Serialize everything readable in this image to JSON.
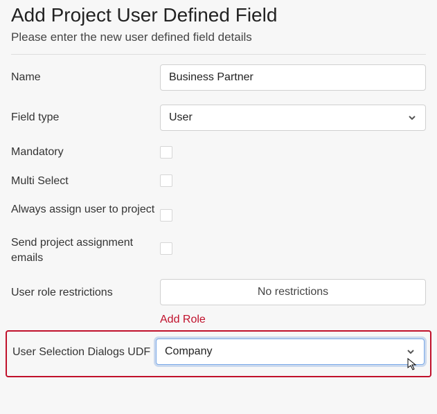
{
  "header": {
    "title": "Add Project User Defined Field",
    "subtitle": "Please enter the new user defined field details"
  },
  "labels": {
    "name": "Name",
    "field_type": "Field type",
    "mandatory": "Mandatory",
    "multi_select": "Multi Select",
    "always_assign": "Always assign user to project",
    "send_emails": "Send project assignment emails",
    "user_role_restrictions": "User role restrictions",
    "user_selection_dialogs": "User Selection Dialogs UDF"
  },
  "values": {
    "name": "Business Partner",
    "field_type": "User",
    "restrictions_text": "No restrictions",
    "user_selection_value": "Company"
  },
  "actions": {
    "add_role": "Add Role"
  }
}
